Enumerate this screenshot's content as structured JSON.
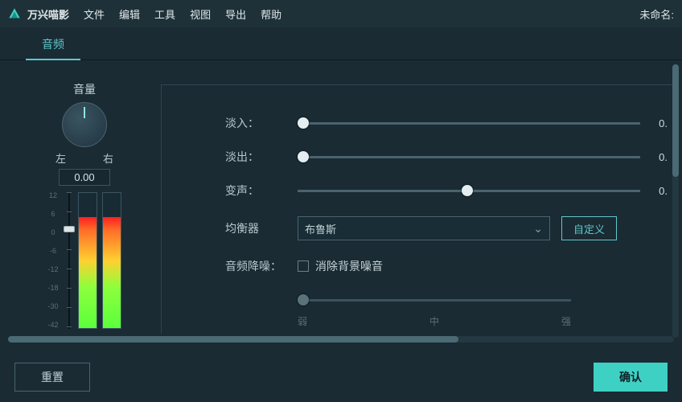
{
  "app": {
    "name": "万兴喵影"
  },
  "menu": {
    "file": "文件",
    "edit": "编辑",
    "tools": "工具",
    "view": "视图",
    "export": "导出",
    "help": "帮助"
  },
  "titleRight": "未命名:",
  "tabs": {
    "audio": "音频"
  },
  "volume": {
    "title": "音量",
    "left": "左",
    "right": "右",
    "value": "0.00",
    "scale": [
      "12",
      "6",
      "0",
      "-6",
      "-12",
      "-18",
      "-30",
      "-42"
    ]
  },
  "params": {
    "fadeIn": {
      "label": "淡入：",
      "value": "0."
    },
    "fadeOut": {
      "label": "淡出：",
      "value": "0."
    },
    "pitch": {
      "label": "变声：",
      "value": "0."
    },
    "eq": {
      "label": "均衡器",
      "selected": "布鲁斯",
      "custom": "自定义"
    },
    "denoise": {
      "label": "音频降噪：",
      "checkbox": "消除背景噪音",
      "low": "弱",
      "mid": "中",
      "high": "强"
    }
  },
  "buttons": {
    "reset": "重置",
    "ok": "确认"
  }
}
